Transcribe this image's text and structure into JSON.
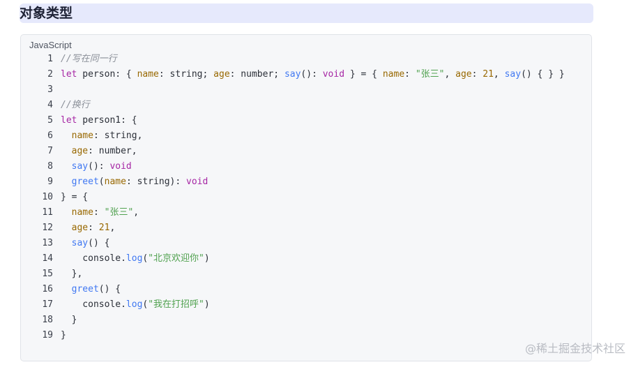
{
  "heading": {
    "title": "对象类型"
  },
  "code_block": {
    "language": "JavaScript",
    "lines": [
      {
        "num": "1",
        "tokens": [
          {
            "t": "//写在同一行",
            "c": "comment"
          }
        ]
      },
      {
        "num": "2",
        "tokens": [
          {
            "t": "let",
            "c": "keyword"
          },
          {
            "t": " person: { ",
            "c": "plain"
          },
          {
            "t": "name",
            "c": "prop"
          },
          {
            "t": ": string; ",
            "c": "plain"
          },
          {
            "t": "age",
            "c": "prop"
          },
          {
            "t": ": number; ",
            "c": "plain"
          },
          {
            "t": "say",
            "c": "func"
          },
          {
            "t": "(): ",
            "c": "plain"
          },
          {
            "t": "void",
            "c": "keyword"
          },
          {
            "t": " } = { ",
            "c": "plain"
          },
          {
            "t": "name",
            "c": "prop"
          },
          {
            "t": ": ",
            "c": "plain"
          },
          {
            "t": "\"张三\"",
            "c": "string"
          },
          {
            "t": ", ",
            "c": "plain"
          },
          {
            "t": "age",
            "c": "prop"
          },
          {
            "t": ": ",
            "c": "plain"
          },
          {
            "t": "21",
            "c": "number"
          },
          {
            "t": ", ",
            "c": "plain"
          },
          {
            "t": "say",
            "c": "func"
          },
          {
            "t": "() { } }",
            "c": "plain"
          }
        ]
      },
      {
        "num": "3",
        "tokens": []
      },
      {
        "num": "4",
        "tokens": [
          {
            "t": "//换行",
            "c": "comment"
          }
        ]
      },
      {
        "num": "5",
        "tokens": [
          {
            "t": "let",
            "c": "keyword"
          },
          {
            "t": " person1: {",
            "c": "plain"
          }
        ]
      },
      {
        "num": "6",
        "tokens": [
          {
            "t": "  ",
            "c": "plain"
          },
          {
            "t": "name",
            "c": "prop"
          },
          {
            "t": ": string,",
            "c": "plain"
          }
        ]
      },
      {
        "num": "7",
        "tokens": [
          {
            "t": "  ",
            "c": "plain"
          },
          {
            "t": "age",
            "c": "prop"
          },
          {
            "t": ": number,",
            "c": "plain"
          }
        ]
      },
      {
        "num": "8",
        "tokens": [
          {
            "t": "  ",
            "c": "plain"
          },
          {
            "t": "say",
            "c": "func"
          },
          {
            "t": "(): ",
            "c": "plain"
          },
          {
            "t": "void",
            "c": "keyword"
          }
        ]
      },
      {
        "num": "9",
        "tokens": [
          {
            "t": "  ",
            "c": "plain"
          },
          {
            "t": "greet",
            "c": "func"
          },
          {
            "t": "(",
            "c": "plain"
          },
          {
            "t": "name",
            "c": "prop"
          },
          {
            "t": ": string): ",
            "c": "plain"
          },
          {
            "t": "void",
            "c": "keyword"
          }
        ]
      },
      {
        "num": "10",
        "tokens": [
          {
            "t": "} = {",
            "c": "plain"
          }
        ]
      },
      {
        "num": "11",
        "tokens": [
          {
            "t": "  ",
            "c": "plain"
          },
          {
            "t": "name",
            "c": "prop"
          },
          {
            "t": ": ",
            "c": "plain"
          },
          {
            "t": "\"张三\"",
            "c": "string"
          },
          {
            "t": ",",
            "c": "plain"
          }
        ]
      },
      {
        "num": "12",
        "tokens": [
          {
            "t": "  ",
            "c": "plain"
          },
          {
            "t": "age",
            "c": "prop"
          },
          {
            "t": ": ",
            "c": "plain"
          },
          {
            "t": "21",
            "c": "number"
          },
          {
            "t": ",",
            "c": "plain"
          }
        ]
      },
      {
        "num": "13",
        "tokens": [
          {
            "t": "  ",
            "c": "plain"
          },
          {
            "t": "say",
            "c": "func"
          },
          {
            "t": "() {",
            "c": "plain"
          }
        ]
      },
      {
        "num": "14",
        "tokens": [
          {
            "t": "    console.",
            "c": "plain"
          },
          {
            "t": "log",
            "c": "func"
          },
          {
            "t": "(",
            "c": "plain"
          },
          {
            "t": "\"北京欢迎你\"",
            "c": "string"
          },
          {
            "t": ")",
            "c": "plain"
          }
        ]
      },
      {
        "num": "15",
        "tokens": [
          {
            "t": "  },",
            "c": "plain"
          }
        ]
      },
      {
        "num": "16",
        "tokens": [
          {
            "t": "  ",
            "c": "plain"
          },
          {
            "t": "greet",
            "c": "func"
          },
          {
            "t": "() {",
            "c": "plain"
          }
        ]
      },
      {
        "num": "17",
        "tokens": [
          {
            "t": "    console.",
            "c": "plain"
          },
          {
            "t": "log",
            "c": "func"
          },
          {
            "t": "(",
            "c": "plain"
          },
          {
            "t": "\"我在打招呼\"",
            "c": "string"
          },
          {
            "t": ")",
            "c": "plain"
          }
        ]
      },
      {
        "num": "18",
        "tokens": [
          {
            "t": "  }",
            "c": "plain"
          }
        ]
      },
      {
        "num": "19",
        "tokens": [
          {
            "t": "}",
            "c": "plain"
          }
        ]
      }
    ]
  },
  "footer": {
    "watermark": "@稀土掘金技术社区"
  },
  "colors": {
    "heading_bg": "#e6e9fc",
    "code_bg": "#f6f7f9",
    "keyword": "#a626a4",
    "property": "#986801",
    "function": "#4078f2",
    "string": "#50a14f",
    "comment": "#8a8f98"
  }
}
